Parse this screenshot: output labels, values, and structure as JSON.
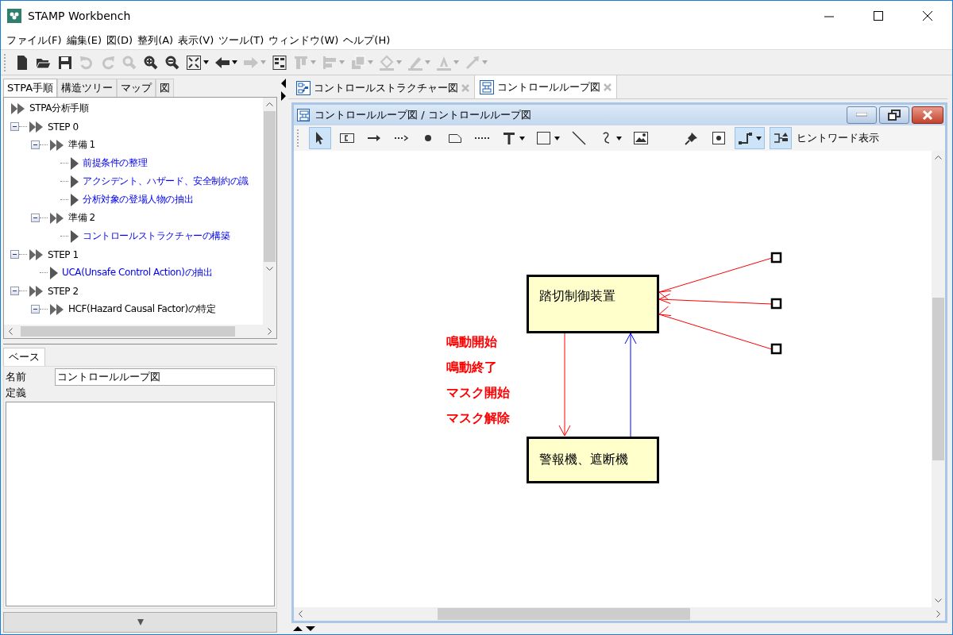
{
  "window": {
    "title": "STAMP Workbench"
  },
  "menu": [
    "ファイル(F)",
    "編集(E)",
    "図(D)",
    "整列(A)",
    "表示(V)",
    "ツール(T)",
    "ウィンドウ(W)",
    "ヘルプ(H)"
  ],
  "toolbar": [
    {
      "disabled": false
    },
    {
      "disabled": false
    },
    {
      "disabled": false
    },
    {
      "disabled": true
    },
    {
      "disabled": true
    },
    {
      "disabled": true
    },
    {
      "disabled": false
    },
    {
      "disabled": false
    },
    {
      "disabled": false,
      "dropdown": true
    },
    {
      "disabled": false,
      "dropdown": true
    },
    {
      "disabled": true,
      "dropdown": true
    },
    {
      "disabled": false
    },
    {
      "disabled": true,
      "dropdown": true
    },
    {
      "disabled": true,
      "dropdown": true
    },
    {
      "disabled": true,
      "dropdown": true
    },
    {
      "disabled": true,
      "dropdown": true
    },
    {
      "disabled": true,
      "dropdown": true
    },
    {
      "disabled": true,
      "dropdown": true
    },
    {
      "disabled": true,
      "dropdown": true
    }
  ],
  "left_tabs": [
    {
      "label": "STPA手順",
      "selected": true
    },
    {
      "label": "構造ツリー",
      "selected": false
    },
    {
      "label": "マップ",
      "selected": false
    },
    {
      "label": "図",
      "selected": false
    }
  ],
  "tree": {
    "label": "STPA分析手順",
    "kind": "group",
    "children": [
      {
        "label": "STEP 0",
        "kind": "group",
        "expanded": true,
        "children": [
          {
            "label": "準備 1",
            "kind": "group",
            "expanded": true,
            "children": [
              {
                "label": "前提条件の整理",
                "kind": "task"
              },
              {
                "label": "アクシデント、ハザード、安全制約の識",
                "kind": "task"
              },
              {
                "label": "分析対象の登場人物の抽出",
                "kind": "task"
              }
            ]
          },
          {
            "label": "準備 2",
            "kind": "group",
            "expanded": true,
            "children": [
              {
                "label": "コントロールストラクチャーの構築",
                "kind": "task"
              }
            ]
          }
        ]
      },
      {
        "label": "STEP 1",
        "kind": "group",
        "expanded": true,
        "children": [
          {
            "label": "UCA(Unsafe Control Action)の抽出",
            "kind": "task"
          }
        ]
      },
      {
        "label": "STEP 2",
        "kind": "group",
        "expanded": true,
        "children": [
          {
            "label": "HCF(Hazard Causal Factor)の特定",
            "kind": "group",
            "expanded": true
          }
        ]
      }
    ]
  },
  "properties": {
    "tabs": [
      {
        "label": "ベース",
        "selected": true
      }
    ],
    "name_label": "名前",
    "name_value": "コントロールループ図",
    "definition_label": "定義"
  },
  "editor_tabs": [
    {
      "label": "コントロールストラクチャー図",
      "selected": false,
      "kind": "structure"
    },
    {
      "label": "コントロールループ図",
      "selected": true,
      "kind": "loop"
    }
  ],
  "internal_window": {
    "title": "コントロールループ図 / コントロールループ図"
  },
  "diagram_toolbar": [
    {
      "selected": true
    },
    {
      "selected": false
    },
    {
      "selected": false
    },
    {
      "selected": false
    },
    {
      "selected": false
    },
    {
      "selected": false
    },
    {
      "selected": false
    },
    {
      "selected": false,
      "dropdown": true
    },
    {
      "selected": false,
      "dropdown": true
    },
    {
      "selected": false
    },
    {
      "selected": false,
      "dropdown": true
    },
    {
      "selected": false
    },
    {
      "selected": false
    },
    {
      "selected": false
    },
    {
      "selected": true,
      "dropdown": true
    },
    {
      "selected": true
    }
  ],
  "hint_label": "ヒントワード表示",
  "diagram": {
    "controller": "踏切制御装置",
    "controlled": "警報機、遮断機",
    "control_actions": [
      "鳴動開始",
      "鳴動終了",
      "マスク開始",
      "マスク解除"
    ]
  }
}
